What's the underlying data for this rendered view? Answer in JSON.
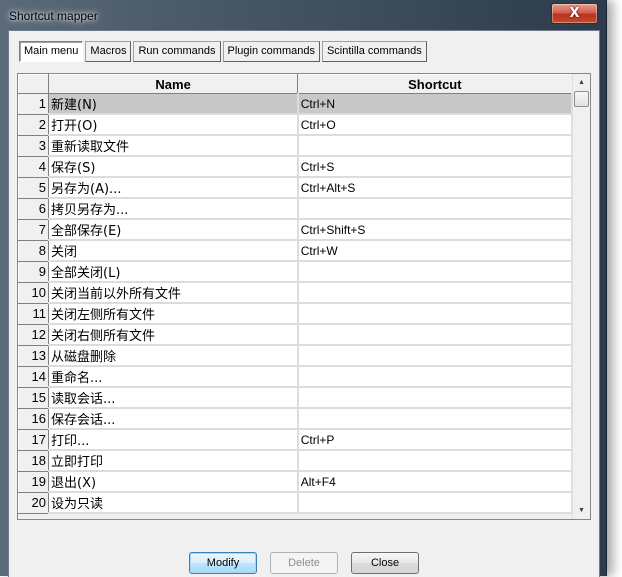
{
  "window": {
    "title": "Shortcut mapper",
    "close_glyph": "X"
  },
  "tabs": [
    {
      "label": "Main menu",
      "active": true
    },
    {
      "label": "Macros",
      "active": false
    },
    {
      "label": "Run commands",
      "active": false
    },
    {
      "label": "Plugin commands",
      "active": false
    },
    {
      "label": "Scintilla commands",
      "active": false
    }
  ],
  "grid": {
    "columns": {
      "name": "Name",
      "shortcut": "Shortcut"
    },
    "selected_row": 1,
    "rows": [
      {
        "num": "1",
        "name": "新建(N)",
        "shortcut": "Ctrl+N"
      },
      {
        "num": "2",
        "name": "打开(O)",
        "shortcut": "Ctrl+O"
      },
      {
        "num": "3",
        "name": "重新读取文件",
        "shortcut": ""
      },
      {
        "num": "4",
        "name": "保存(S)",
        "shortcut": "Ctrl+S"
      },
      {
        "num": "5",
        "name": "另存为(A)...",
        "shortcut": "Ctrl+Alt+S"
      },
      {
        "num": "6",
        "name": "拷贝另存为...",
        "shortcut": ""
      },
      {
        "num": "7",
        "name": "全部保存(E)",
        "shortcut": "Ctrl+Shift+S"
      },
      {
        "num": "8",
        "name": "关闭",
        "shortcut": "Ctrl+W"
      },
      {
        "num": "9",
        "name": "全部关闭(L)",
        "shortcut": ""
      },
      {
        "num": "10",
        "name": "关闭当前以外所有文件",
        "shortcut": ""
      },
      {
        "num": "11",
        "name": "关闭左侧所有文件",
        "shortcut": ""
      },
      {
        "num": "12",
        "name": "关闭右侧所有文件",
        "shortcut": ""
      },
      {
        "num": "13",
        "name": "从磁盘删除",
        "shortcut": ""
      },
      {
        "num": "14",
        "name": "重命名...",
        "shortcut": ""
      },
      {
        "num": "15",
        "name": "读取会话...",
        "shortcut": ""
      },
      {
        "num": "16",
        "name": "保存会话...",
        "shortcut": ""
      },
      {
        "num": "17",
        "name": "打印...",
        "shortcut": "Ctrl+P"
      },
      {
        "num": "18",
        "name": "立即打印",
        "shortcut": ""
      },
      {
        "num": "19",
        "name": "退出(X)",
        "shortcut": "Alt+F4"
      },
      {
        "num": "20",
        "name": "设为只读",
        "shortcut": ""
      }
    ]
  },
  "scrollbar": {
    "up_glyph": "▲",
    "down_glyph": "▼"
  },
  "buttons": {
    "modify": {
      "label": "Modify",
      "enabled": true
    },
    "delete": {
      "label": "Delete",
      "enabled": false
    },
    "close": {
      "label": "Close",
      "enabled": true
    }
  }
}
